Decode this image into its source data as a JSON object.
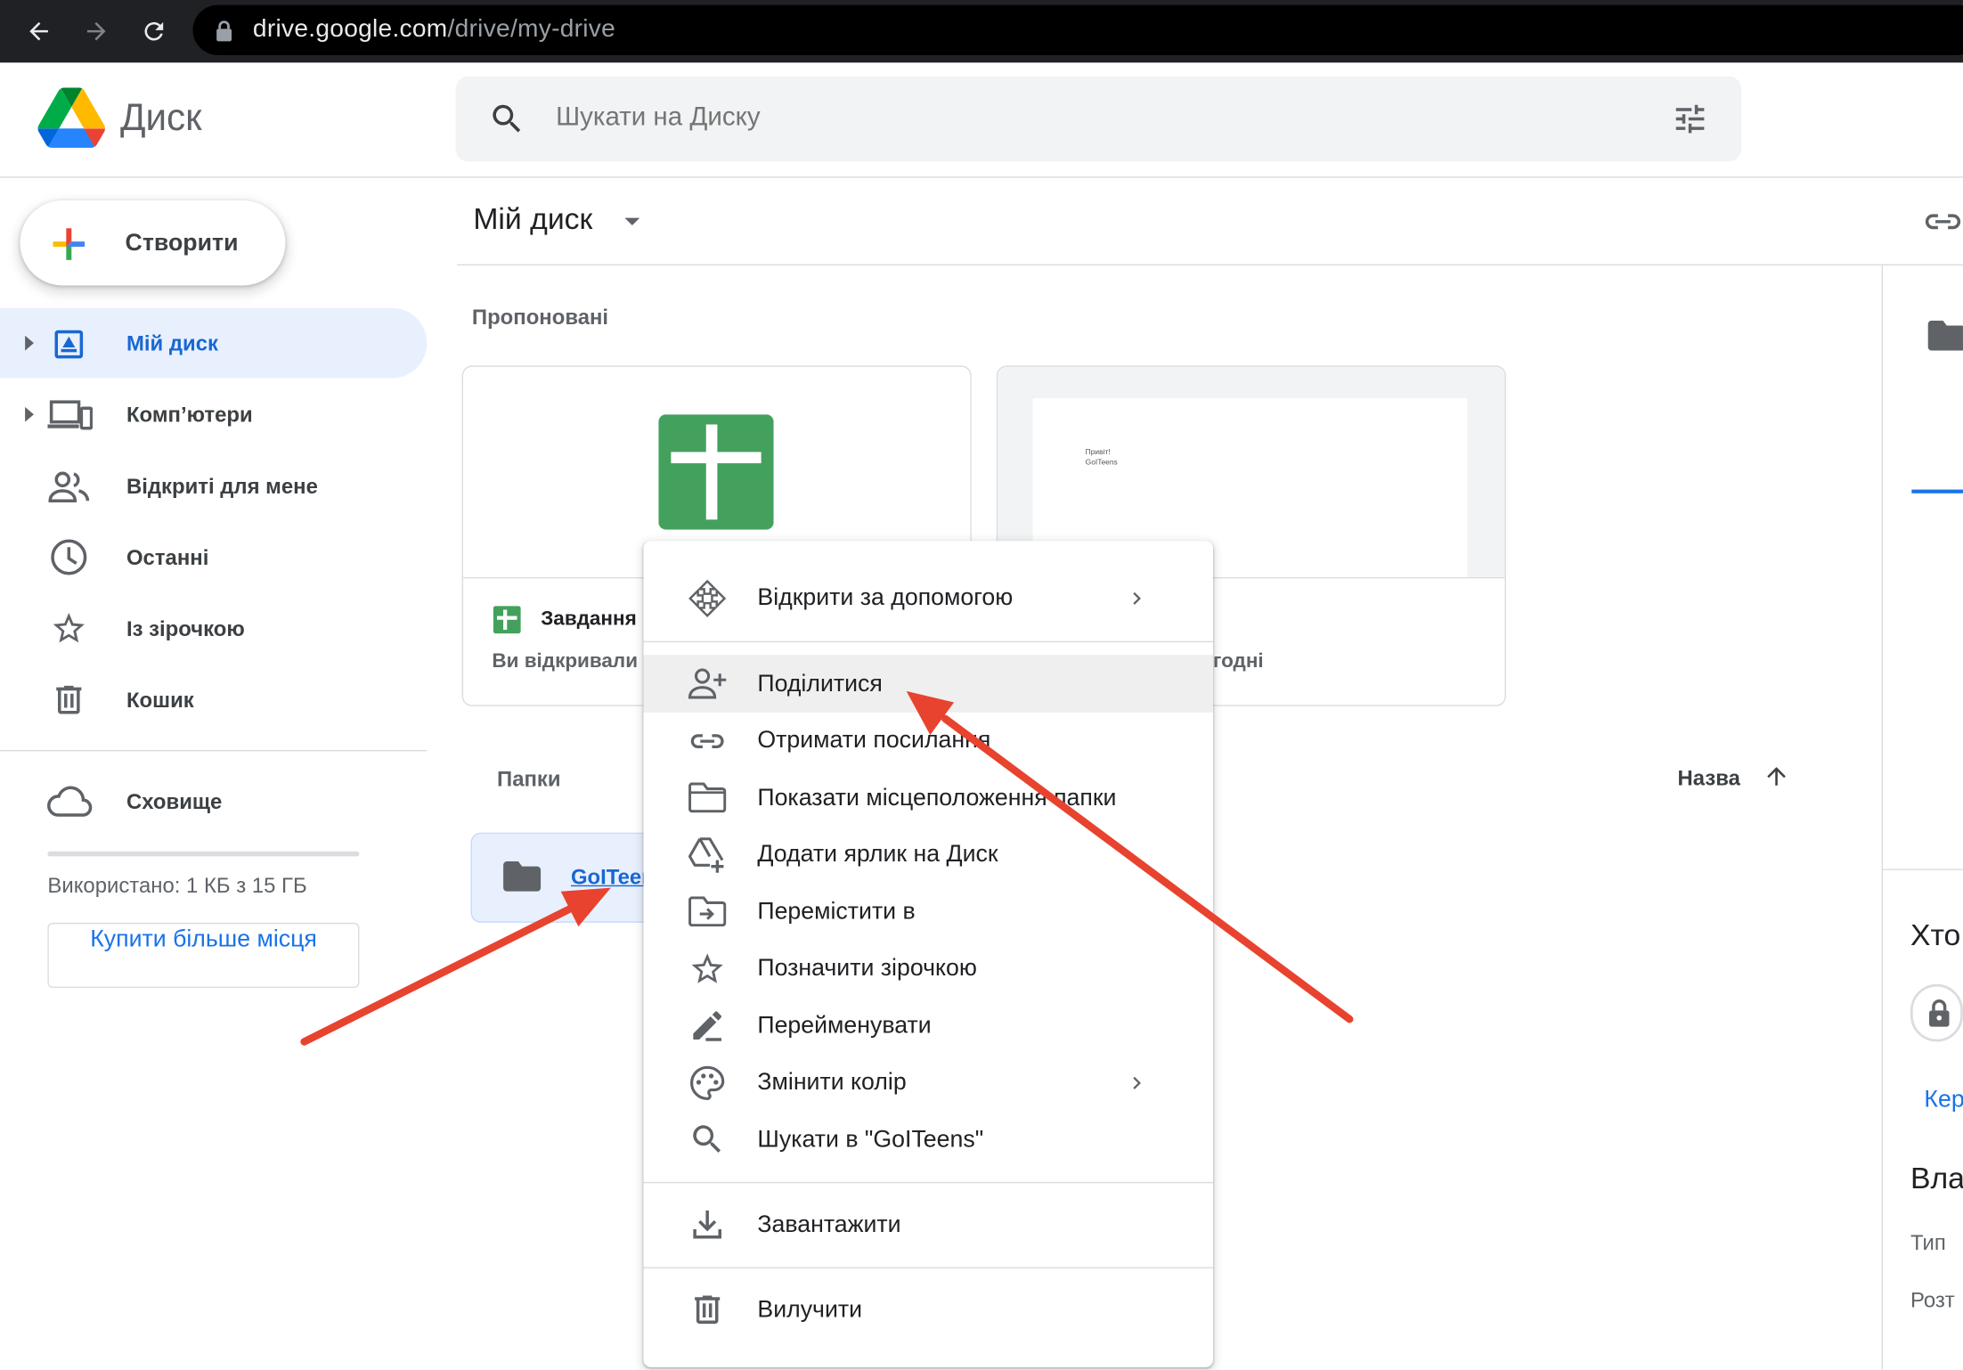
{
  "browser": {
    "url_host": "drive.google.com",
    "url_path": "/drive/my-drive"
  },
  "app": {
    "title": "Диск",
    "search_placeholder": "Шукати на Диску"
  },
  "sidebar": {
    "create_label": "Створити",
    "items": [
      {
        "label": "Мій диск",
        "icon": "my-drive-icon",
        "active": true
      },
      {
        "label": "Комп’ютери",
        "icon": "computers-icon"
      },
      {
        "label": "Відкриті для мене",
        "icon": "shared-icon"
      },
      {
        "label": "Останні",
        "icon": "clock-icon"
      },
      {
        "label": "Із зірочкою",
        "icon": "star-icon"
      },
      {
        "label": "Кошик",
        "icon": "trash-icon"
      }
    ],
    "storage_label": "Сховище",
    "storage_used_fraction": 0.0,
    "storage_text": "Використано: 1 КБ з 15 ГБ",
    "buy_label": "Купити більше місця"
  },
  "main": {
    "title": "Мій диск",
    "suggested_label": "Пропоновані",
    "cards": [
      {
        "name": "Завдання",
        "sub": "Ви відкривали"
      },
      {
        "name": "",
        "sub": "годні",
        "doc_preview_line1": "Привіт!",
        "doc_preview_line2": "GoITeens"
      }
    ],
    "folders_label": "Папки",
    "sort_label": "Назва",
    "folder_name": "GoITeens"
  },
  "right_panel": {
    "who_partial": "Хто",
    "manage_partial": "Кер",
    "owner_partial": "Вла",
    "type_partial": "Тип",
    "location_partial": "Розт"
  },
  "context_menu": {
    "items": [
      {
        "label": "Відкрити за допомогою",
        "icon": "open-with-icon",
        "submenu": true
      },
      {
        "label": "Поділитися",
        "icon": "share-person-icon",
        "highlighted": true
      },
      {
        "label": "Отримати посилання",
        "icon": "link-icon"
      },
      {
        "label": "Показати місцеположення папки",
        "icon": "folder-icon"
      },
      {
        "label": "Додати ярлик на Диск",
        "icon": "add-shortcut-icon"
      },
      {
        "label": "Перемістити в",
        "icon": "move-icon"
      },
      {
        "label": "Позначити зірочкою",
        "icon": "star-icon"
      },
      {
        "label": "Перейменувати",
        "icon": "rename-icon"
      },
      {
        "label": "Змінити колір",
        "icon": "palette-icon",
        "submenu": true
      },
      {
        "label": "Шукати в \"GoITeens\"",
        "icon": "search-icon"
      },
      {
        "label": "Завантажити",
        "icon": "download-icon"
      },
      {
        "label": "Вилучити",
        "icon": "trash-icon"
      }
    ]
  },
  "colors": {
    "accent": "#1a73e8",
    "active_bg": "#e8f0fe",
    "annotation_arrow": "#e8432e",
    "sheets_green": "#43a15d"
  }
}
